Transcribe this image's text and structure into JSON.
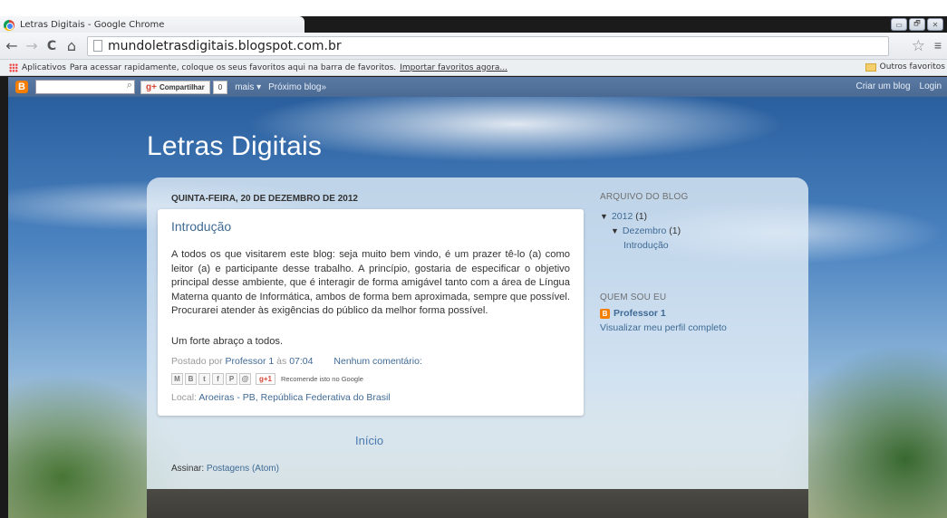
{
  "window": {
    "tab_title": "Letras Digitais - Google Chrome",
    "controls": [
      "▭",
      "🗗",
      "✕"
    ]
  },
  "toolbar": {
    "back": "←",
    "forward": "→",
    "reload": "C",
    "home": "⌂",
    "url": "mundoletrasdigitais.blogspot.com.br",
    "star": "☆",
    "menu": "≡"
  },
  "bookmarks": {
    "apps_label": "Aplicativos",
    "hint": "Para acessar rapidamente, coloque os seus favoritos aqui na barra de favoritos.",
    "import_link": "Importar favoritos agora...",
    "other": "Outros favoritos"
  },
  "navbar": {
    "logo": "B",
    "search_icon": "🔍",
    "share_label": "Compartilhar",
    "share_g": "g+",
    "share_count": "0",
    "more": "mais ▾",
    "next_blog": "Próximo blog»",
    "create_blog": "Criar um blog",
    "login": "Login"
  },
  "blog": {
    "title": "Letras Digitais",
    "date_header": "QUINTA-FEIRA, 20 DE DEZEMBRO DE 2012",
    "post": {
      "title": "Introdução",
      "body": "A todos os que visitarem este blog: seja muito bem vindo, é um prazer tê-lo (a) como leitor (a) e participante desse trabalho. A princípio, gostaria de especificar o objetivo principal desse ambiente, que é interagir de forma amigável tanto com a área de Língua Materna quanto de Informática, ambos de forma bem aproximada, sempre que possível. Procurarei atender às exigências do público da melhor forma possível.",
      "greeting": "Um forte abraço a todos.",
      "posted_by_prefix": "Postado por",
      "author": "Professor 1",
      "at": "às",
      "time": "07:04",
      "comments": "Nenhum comentário:",
      "share_icons": [
        "M",
        "B",
        "t",
        "f",
        "P",
        "@"
      ],
      "plus_one": "g+1",
      "recommend": "Recomende isto no Google",
      "location_prefix": "Local:",
      "location": "Aroeiras - PB, República Federativa do Brasil"
    },
    "home_link": "Início",
    "subscribe_prefix": "Assinar:",
    "subscribe_link": "Postagens (Atom)"
  },
  "sidebar": {
    "archive_head": "ARQUIVO DO BLOG",
    "year": "2012",
    "year_count": "(1)",
    "month": "Dezembro",
    "month_count": "(1)",
    "post_link": "Introdução",
    "tri": "▼",
    "about_head": "QUEM SOU EU",
    "profile_icon": "B",
    "profile_name": "Professor 1",
    "view_profile": "Visualizar meu perfil completo"
  }
}
